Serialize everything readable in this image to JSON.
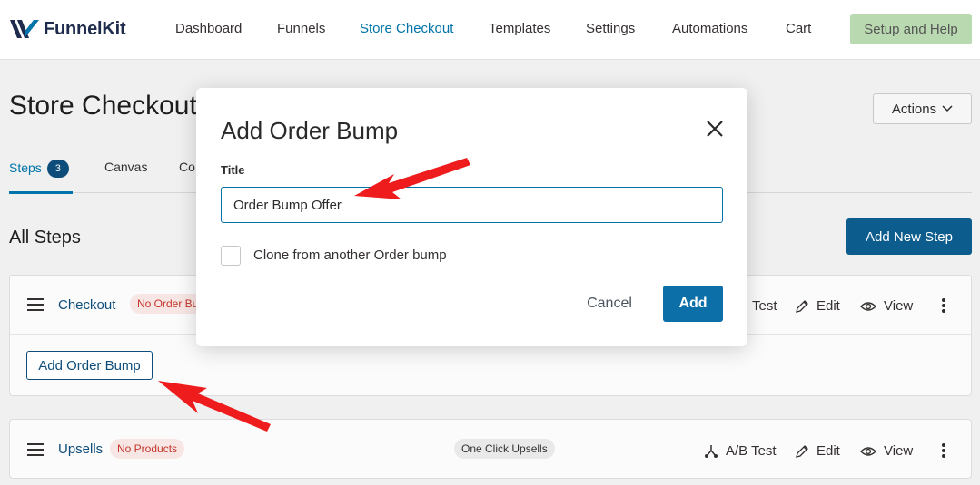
{
  "brand": {
    "name": "FunnelKit"
  },
  "nav": {
    "items": [
      {
        "label": "Dashboard",
        "active": false
      },
      {
        "label": "Funnels",
        "active": false
      },
      {
        "label": "Store Checkout",
        "active": true
      },
      {
        "label": "Templates",
        "active": false
      },
      {
        "label": "Settings",
        "active": false
      },
      {
        "label": "Automations",
        "active": false
      },
      {
        "label": "Cart",
        "active": false
      }
    ],
    "setup_label": "Setup and Help"
  },
  "page": {
    "title": "Store Checkout",
    "actions_label": "Actions",
    "tabs": [
      {
        "label": "Steps",
        "count": "3"
      },
      {
        "label": "Canvas"
      },
      {
        "label": "Co"
      }
    ],
    "section_title": "All Steps",
    "add_step_label": "Add New Step",
    "steps": [
      {
        "name": "Checkout",
        "badge": "No Order Bu",
        "actions": {
          "ab": "Test",
          "edit": "Edit",
          "view": "View"
        },
        "add_bump_label": "Add Order Bump"
      },
      {
        "name": "Upsells",
        "badge": "No Products",
        "type_badge": "One Click Upsells",
        "actions": {
          "ab": "A/B Test",
          "edit": "Edit",
          "view": "View"
        }
      }
    ]
  },
  "modal": {
    "title": "Add Order Bump",
    "field_label": "Title",
    "title_value": "Order Bump Offer",
    "clone_label": "Clone from another Order bump",
    "cancel_label": "Cancel",
    "add_label": "Add"
  },
  "colors": {
    "accent": "#0073aa",
    "primary_button": "#0d6fa8",
    "annotation_arrow": "#ee1c1c"
  }
}
